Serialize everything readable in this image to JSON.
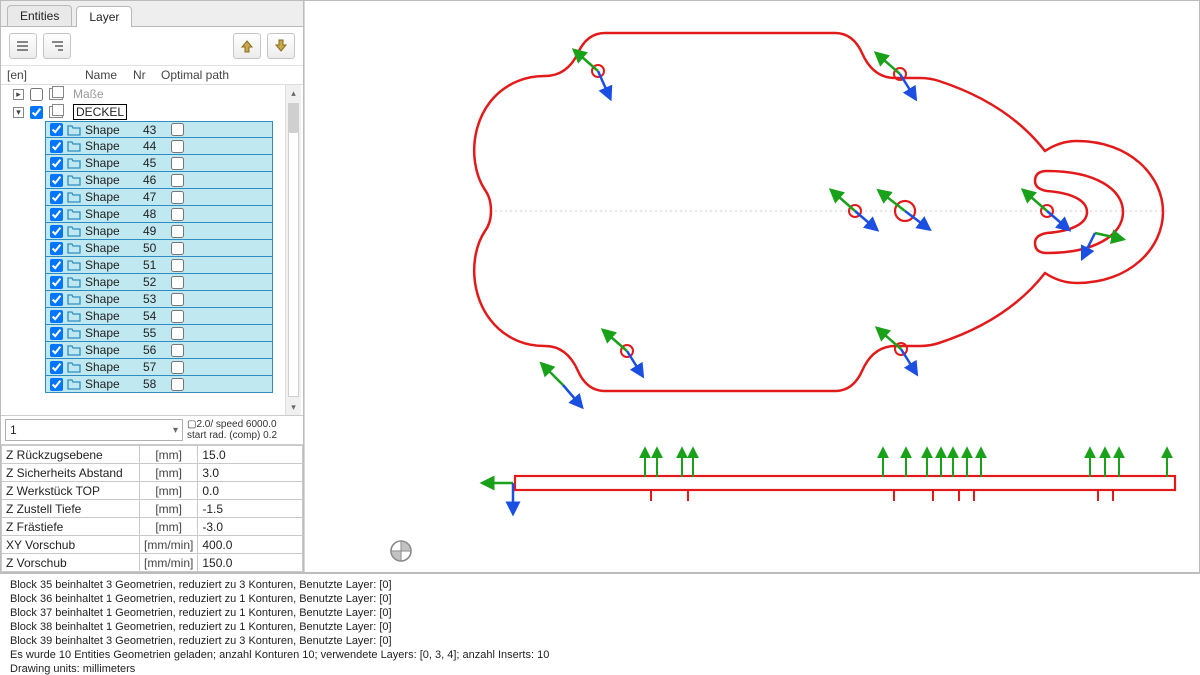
{
  "tabs": {
    "entities": "Entities",
    "layer": "Layer"
  },
  "tree_header": {
    "en": "[en]",
    "name": "Name",
    "nr": "Nr",
    "optimal": "Optimal path"
  },
  "layers": {
    "masse": {
      "label": "Maße",
      "checked": false,
      "expanded": false
    },
    "deckel": {
      "label": "DECKEL",
      "checked": true,
      "expanded": true
    }
  },
  "shape_label": "Shape",
  "shapes": [
    43,
    44,
    45,
    46,
    47,
    48,
    49,
    50,
    51,
    52,
    53,
    54,
    55,
    56,
    57,
    58
  ],
  "tool": {
    "selected": "1",
    "desc_line1": "▢2.0/ speed 6000.0",
    "desc_line2": "start rad. (comp) 0.2"
  },
  "params": [
    {
      "label": "Z Rückzugsebene",
      "unit": "[mm]",
      "value": "15.0"
    },
    {
      "label": "Z Sicherheits Abstand",
      "unit": "[mm]",
      "value": "3.0"
    },
    {
      "label": "Z Werkstück TOP",
      "unit": "[mm]",
      "value": "0.0"
    },
    {
      "label": "Z Zustell Tiefe",
      "unit": "[mm]",
      "value": "-1.5"
    },
    {
      "label": "Z Frästiefe",
      "unit": "[mm]",
      "value": "-3.0"
    },
    {
      "label": "XY Vorschub",
      "unit": "[mm/min]",
      "value": "400.0"
    },
    {
      "label": "Z Vorschub",
      "unit": "[mm/min]",
      "value": "150.0"
    }
  ],
  "console": [
    "Block 35 beinhaltet 3 Geometrien, reduziert zu 3 Konturen, Benutzte Layer: [0]",
    "Block 36 beinhaltet 1 Geometrien, reduziert zu 1 Konturen, Benutzte Layer: [0]",
    "Block 37 beinhaltet 1 Geometrien, reduziert zu 1 Konturen, Benutzte Layer: [0]",
    "Block 38 beinhaltet 1 Geometrien, reduziert zu 1 Konturen, Benutzte Layer: [0]",
    "Block 39 beinhaltet 3 Geometrien, reduziert zu 3 Konturen, Benutzte Layer: [0]",
    "Es wurde 10 Entities Geometrien geladen; anzahl Konturen 10; verwendete Layers: [0, 3, 4]; anzahl Inserts: 10",
    "Drawing units: millimeters"
  ],
  "icons": {
    "collapse_all": "collapse-all-icon",
    "expand_all": "expand-all-icon",
    "move_up": "arrow-up-icon",
    "move_down": "arrow-down-icon",
    "scroll_up": "▴",
    "scroll_down": "▾",
    "dropdown": "▾"
  },
  "colors": {
    "contour_stroke": "#e21a1a",
    "arrow_green": "#1aa11a",
    "arrow_blue": "#1a4fe2",
    "circle_stroke": "#e21a1a",
    "selection_bg": "#bfe8f0",
    "selection_border": "#2e8dc0"
  }
}
